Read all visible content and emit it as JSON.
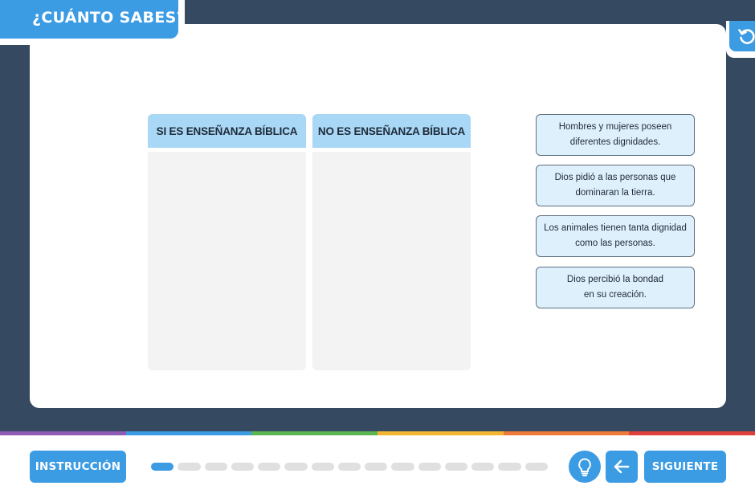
{
  "header": {
    "title": "¿CUÁNTO SABES?",
    "reset_icon": "undo-icon"
  },
  "columns": [
    {
      "label": "SI ES ENSEÑANZA BÍBLICA"
    },
    {
      "label": "NO ES ENSEÑANZA BÍBLICA"
    }
  ],
  "cards": [
    {
      "text": "Hombres y mujeres poseen\ndiferentes dignidades."
    },
    {
      "text": "Dios pidió a las personas que\ndominaran la tierra."
    },
    {
      "text": "Los animales tienen tanta dignidad\ncomo las personas."
    },
    {
      "text": "Dios percibió la bondad\nen su creación."
    }
  ],
  "footer": {
    "instruction_label": "INSTRUCCIÓN",
    "next_label": "SIGUIENTE",
    "hint_icon": "lightbulb-icon",
    "back_icon": "arrow-left-icon",
    "progress": {
      "current": 1,
      "total": 15
    }
  },
  "colors": {
    "accent": "#3b9be3",
    "frame": "#354a60",
    "column_header": "#a9d7f6",
    "card_bg": "#dff0fd",
    "progress_active": "#3b9be3",
    "progress_inactive": "#e0e0e0",
    "rainbow": [
      "#8e5bb5",
      "#3b9be3",
      "#5ab552",
      "#f2b632",
      "#ee7a3c",
      "#e0403c"
    ]
  }
}
